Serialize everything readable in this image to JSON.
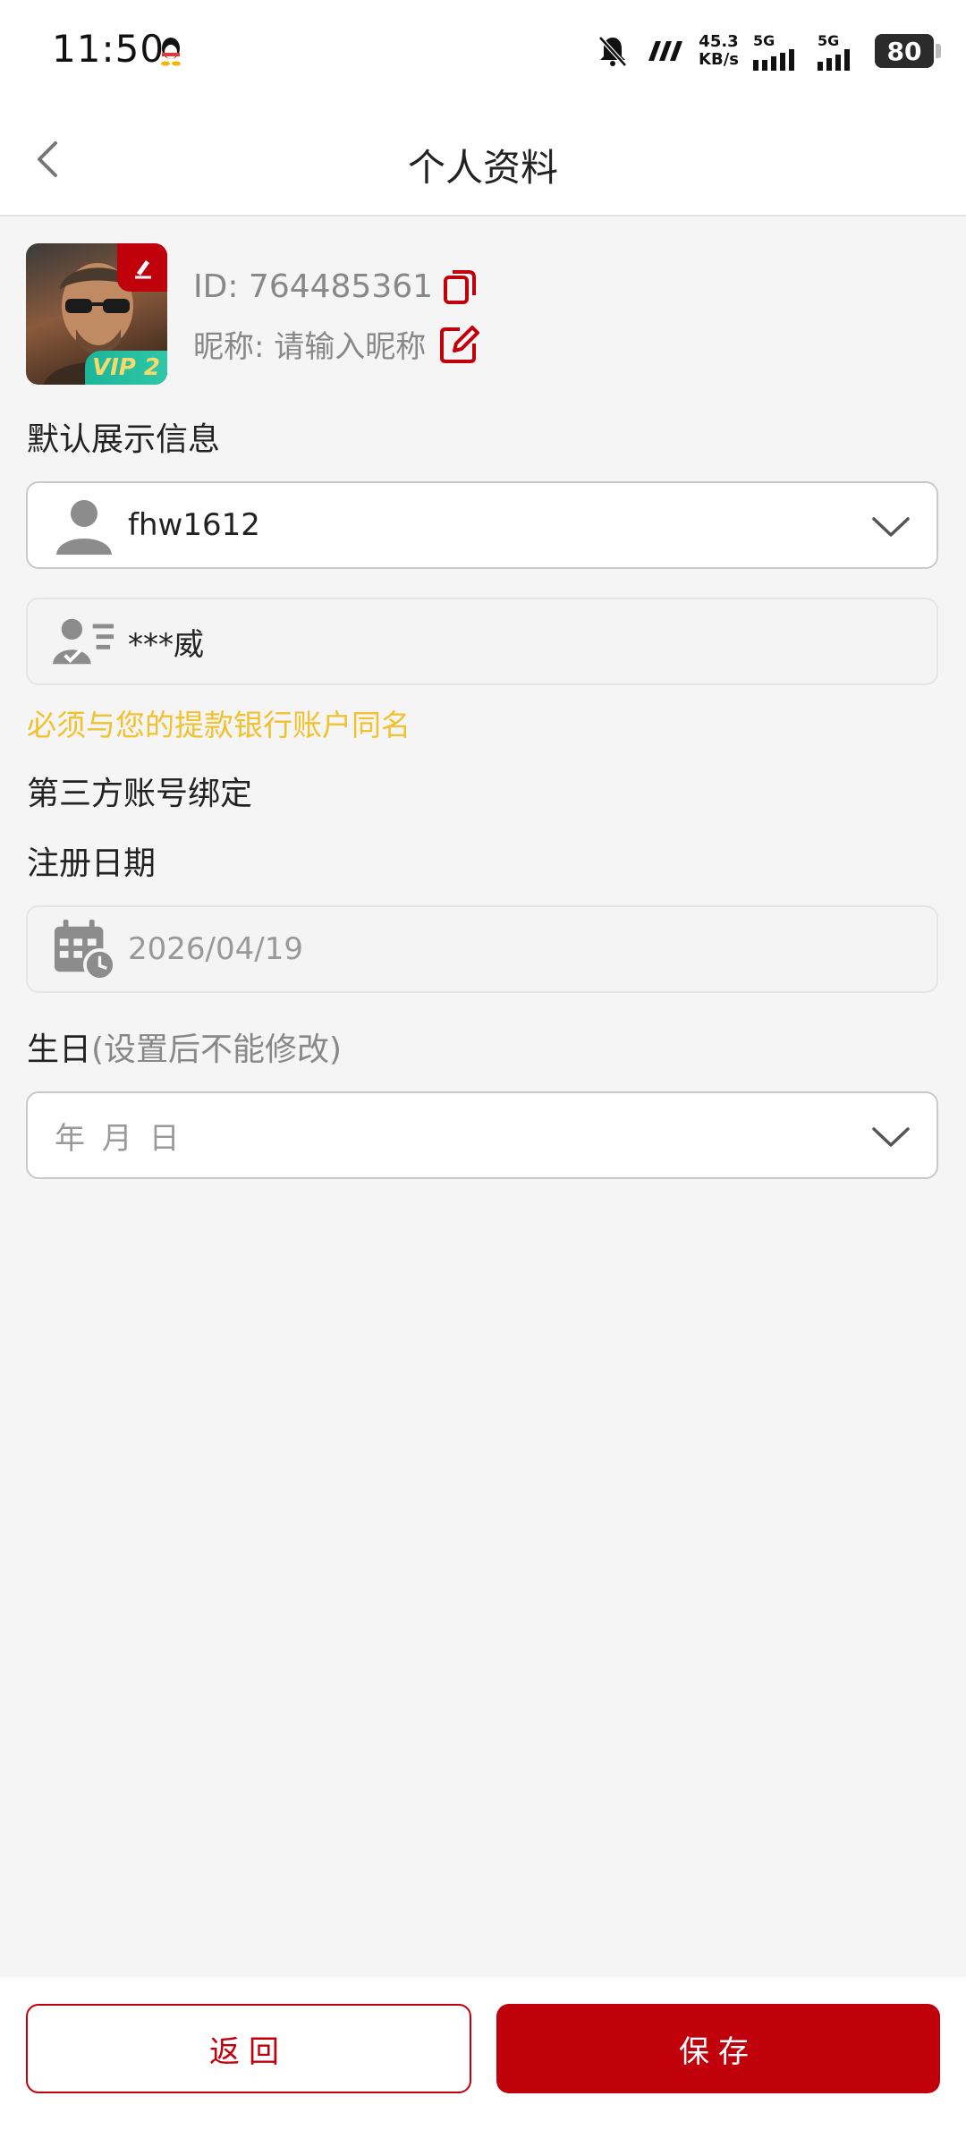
{
  "status_bar": {
    "time": "11:50",
    "net_speed_value": "45.3",
    "net_speed_unit": "KB/s",
    "sim1_label": "5G",
    "sim2_label": "5G",
    "battery": "80"
  },
  "header": {
    "title": "个人资料"
  },
  "profile": {
    "id_text": "ID: 764485361",
    "nickname_text": "昵称: 请输入昵称",
    "vip_label": "VIP 2"
  },
  "display_info": {
    "section_label": "默认展示信息",
    "username": "fhw1612",
    "real_name": "***威",
    "warning": "必须与您的提款银行账户同名"
  },
  "third_party": {
    "section_label": "第三方账号绑定"
  },
  "register": {
    "section_label": "注册日期",
    "date": "2026/04/19"
  },
  "birthday": {
    "section_label": "生日",
    "hint": "(设置后不能修改)",
    "placeholder": "年 月 日"
  },
  "footer": {
    "back_label": "返回",
    "save_label": "保存"
  },
  "colors": {
    "accent": "#c0000b",
    "warning": "#f2c12e",
    "background": "#f5f5f5"
  }
}
